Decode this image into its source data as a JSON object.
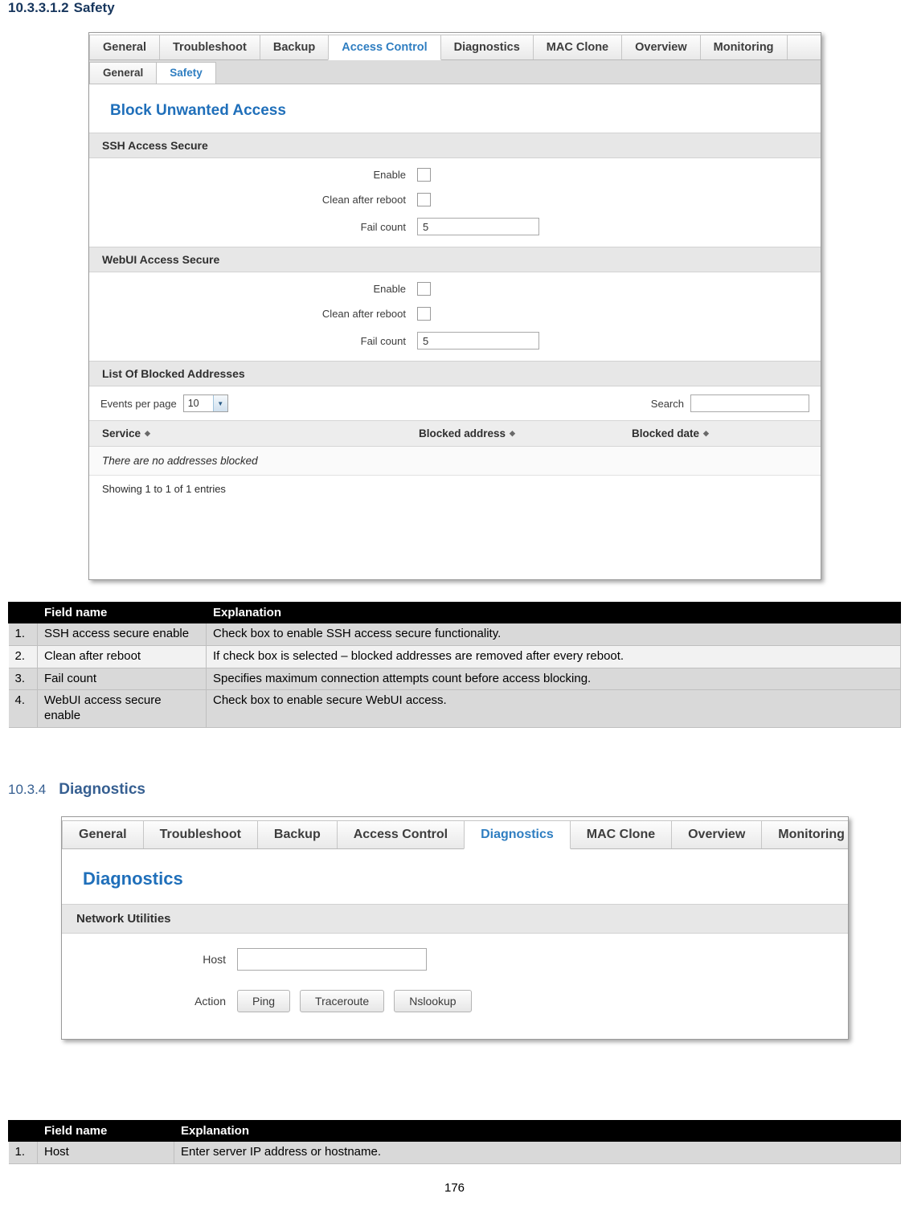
{
  "headings": {
    "safety_num": "10.3.3.1.2",
    "safety_text": "Safety",
    "diagnostics_num": "10.3.4",
    "diagnostics_text": "Diagnostics"
  },
  "safety_shot": {
    "tabs": [
      {
        "label": "General",
        "active": false
      },
      {
        "label": "Troubleshoot",
        "active": false
      },
      {
        "label": "Backup",
        "active": false
      },
      {
        "label": "Access Control",
        "active": true
      },
      {
        "label": "Diagnostics",
        "active": false
      },
      {
        "label": "MAC Clone",
        "active": false
      },
      {
        "label": "Overview",
        "active": false
      },
      {
        "label": "Monitoring",
        "active": false
      }
    ],
    "subtabs": [
      {
        "label": "General",
        "active": false
      },
      {
        "label": "Safety",
        "active": true
      }
    ],
    "panel_title": "Block Unwanted Access",
    "ssh_section": "SSH Access Secure",
    "ssh_fields": {
      "enable_label": "Enable",
      "clean_label": "Clean after reboot",
      "fail_label": "Fail count",
      "fail_value": "5"
    },
    "webui_section": "WebUI Access Secure",
    "webui_fields": {
      "enable_label": "Enable",
      "clean_label": "Clean after reboot",
      "fail_label": "Fail count",
      "fail_value": "5"
    },
    "list_section": "List Of Blocked Addresses",
    "events_label": "Events per page",
    "events_value": "10",
    "search_label": "Search",
    "search_value": "",
    "table_headers": {
      "service": "Service",
      "blocked_address": "Blocked address",
      "blocked_date": "Blocked date"
    },
    "empty_text": "There are no addresses blocked",
    "footer_text": "Showing 1 to 1 of 1 entries"
  },
  "safety_table": {
    "headers": {
      "idx": "",
      "field": "Field name",
      "explanation": "Explanation"
    },
    "rows": [
      {
        "idx": "1.",
        "field": "SSH access  secure enable",
        "explanation": "Check box to enable SSH access secure functionality."
      },
      {
        "idx": "2.",
        "field": "Clean after reboot",
        "explanation": "If check box is selected – blocked addresses are removed after every reboot."
      },
      {
        "idx": "3.",
        "field": "Fail count",
        "explanation": "Specifies maximum connection attempts count before access blocking."
      },
      {
        "idx": "4.",
        "field": "WebUI access secure enable",
        "explanation": "Check box to enable secure WebUI access."
      }
    ]
  },
  "diagnostics_shot": {
    "tabs": [
      {
        "label": "General",
        "active": false
      },
      {
        "label": "Troubleshoot",
        "active": false
      },
      {
        "label": "Backup",
        "active": false
      },
      {
        "label": "Access Control",
        "active": false
      },
      {
        "label": "Diagnostics",
        "active": true
      },
      {
        "label": "MAC Clone",
        "active": false
      },
      {
        "label": "Overview",
        "active": false
      },
      {
        "label": "Monitoring",
        "active": false
      }
    ],
    "panel_title": "Diagnostics",
    "section": "Network Utilities",
    "host_label": "Host",
    "host_value": "",
    "action_label": "Action",
    "buttons": [
      "Ping",
      "Traceroute",
      "Nslookup"
    ]
  },
  "diagnostics_table": {
    "headers": {
      "idx": "",
      "field": "Field name",
      "explanation": "Explanation"
    },
    "rows": [
      {
        "idx": "1.",
        "field": "Host",
        "explanation": "Enter server IP address or hostname."
      }
    ]
  },
  "page_number": "176"
}
